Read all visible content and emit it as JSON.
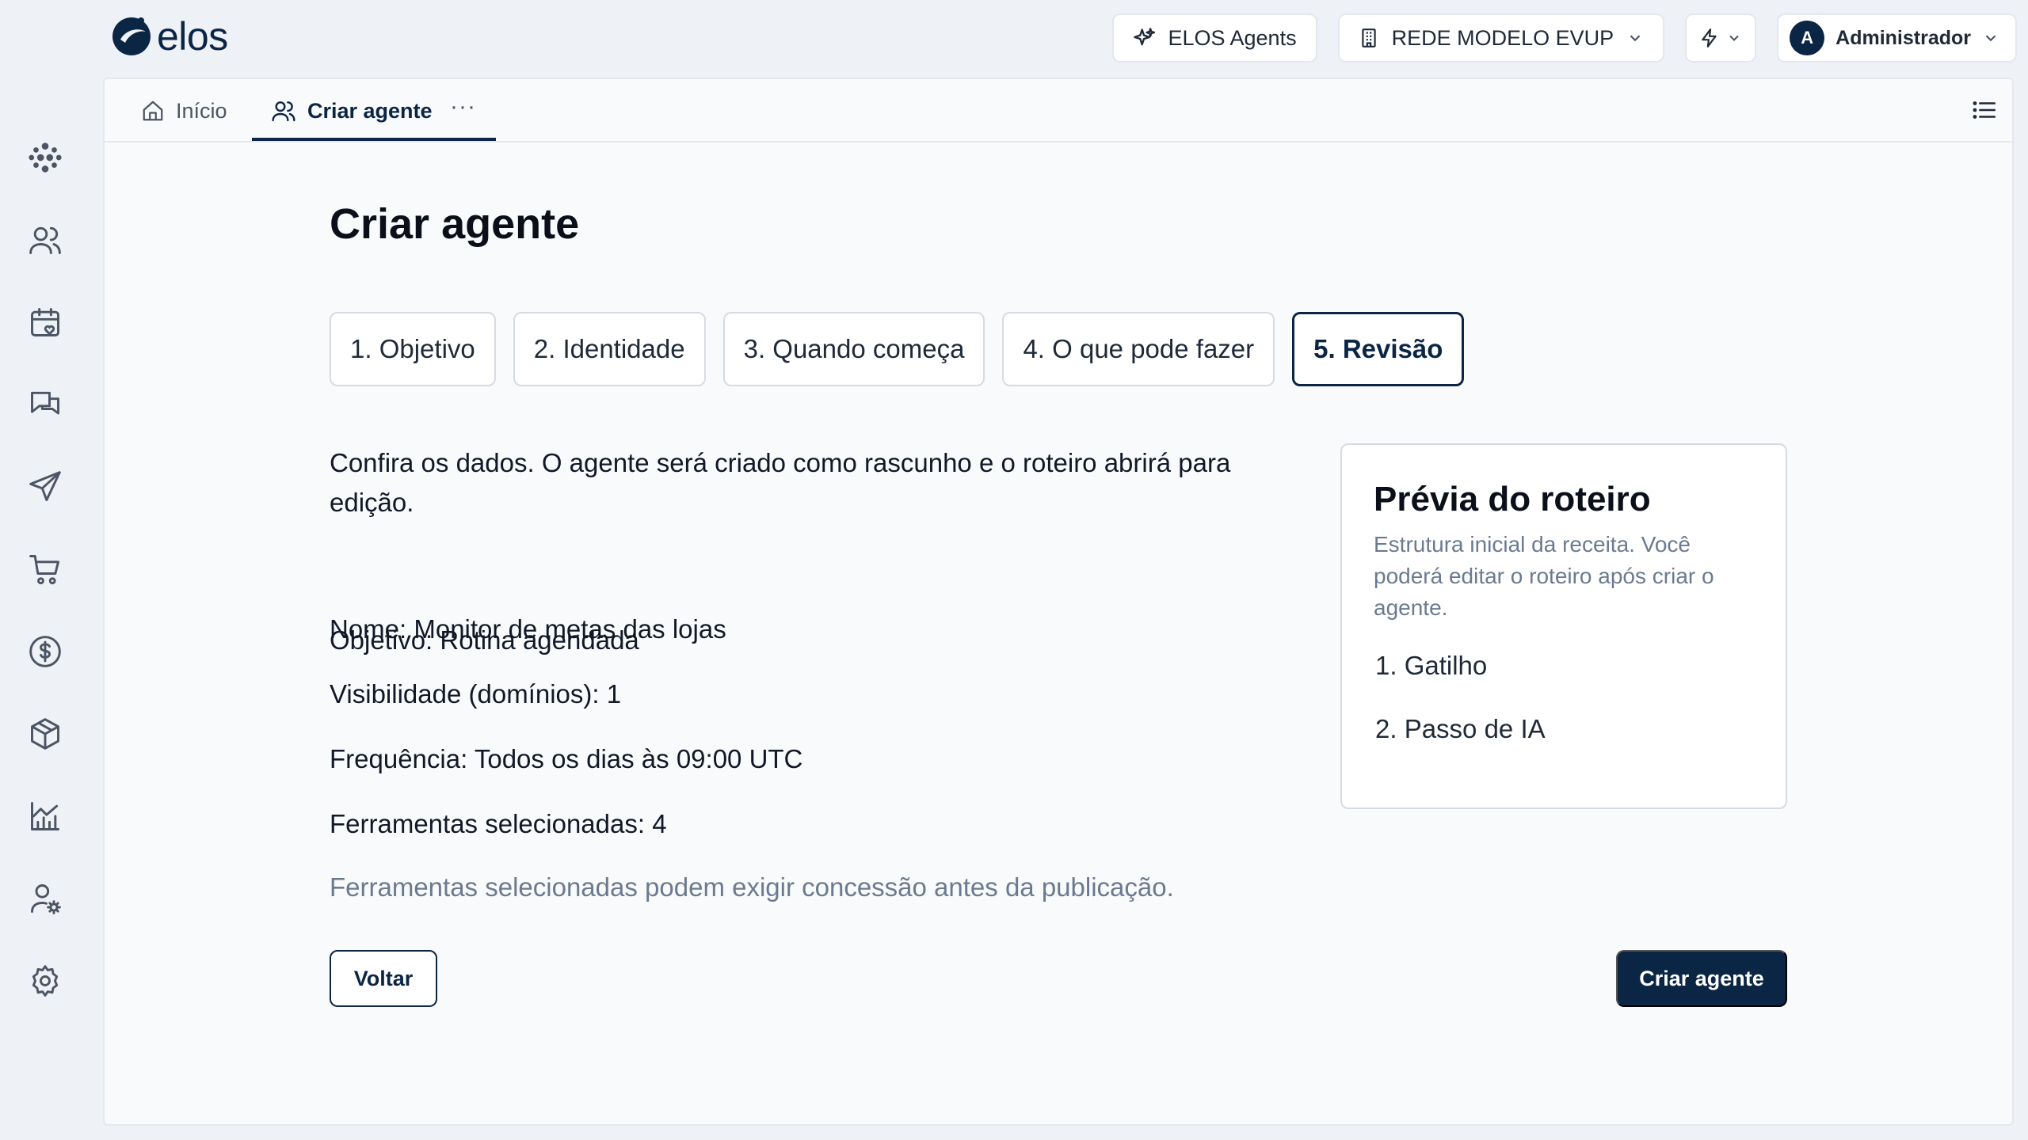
{
  "app": {
    "logo_text": "elos"
  },
  "header": {
    "agents_label": "ELOS Agents",
    "network_label": "REDE MODELO EVUP",
    "user_initial": "A",
    "user_name": "Administrador"
  },
  "sidebar": {
    "items": [
      {
        "name": "dashboard",
        "icon": "dots-cluster-icon"
      },
      {
        "name": "users",
        "icon": "users-icon"
      },
      {
        "name": "calendar",
        "icon": "calendar-heart-icon"
      },
      {
        "name": "messages",
        "icon": "messages-icon"
      },
      {
        "name": "send",
        "icon": "send-icon"
      },
      {
        "name": "cart",
        "icon": "cart-icon"
      },
      {
        "name": "finance",
        "icon": "dollar-icon"
      },
      {
        "name": "products",
        "icon": "box-icon"
      },
      {
        "name": "reports",
        "icon": "chart-icon"
      },
      {
        "name": "user-settings",
        "icon": "user-cog-icon"
      },
      {
        "name": "settings",
        "icon": "gear-icon"
      }
    ]
  },
  "tabs": {
    "home_label": "Início",
    "active_label": "Criar agente",
    "more_label": "···"
  },
  "page": {
    "title": "Criar agente",
    "steps": [
      {
        "label": "1. Objetivo",
        "active": false
      },
      {
        "label": "2. Identidade",
        "active": false
      },
      {
        "label": "3. Quando começa",
        "active": false
      },
      {
        "label": "4. O que pode fazer",
        "active": false
      },
      {
        "label": "5. Revisão",
        "active": true
      }
    ],
    "summary": {
      "intro": "Confira os dados. O agente será criado como rascunho e o roteiro abrirá para edição.",
      "objective": "Objetivo: Rotina agendada",
      "name": "Nome: Monitor de metas das lojas",
      "visibility": "Visibilidade (domínios): 1",
      "frequency": "Frequência: Todos os dias às 09:00 UTC",
      "tools": "Ferramentas selecionadas: 4",
      "note": "Ferramentas selecionadas podem exigir concessão antes da publicação."
    },
    "preview": {
      "title": "Prévia do roteiro",
      "description": "Estrutura inicial da receita. Você poderá editar o roteiro após criar o agente.",
      "items": [
        "1. Gatilho",
        "2. Passo de IA"
      ]
    },
    "back_label": "Voltar",
    "create_label": "Criar agente"
  },
  "colors": {
    "brand": "#0b2545",
    "background": "#eef1f5",
    "panel": "#f9fafb",
    "muted_text": "#6b7a90"
  }
}
